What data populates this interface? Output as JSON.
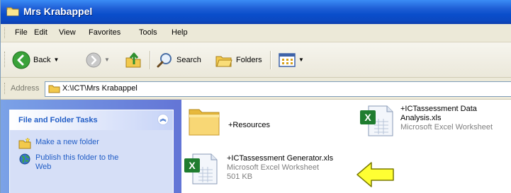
{
  "window": {
    "title": "Mrs Krabappel"
  },
  "menu": [
    "File",
    "Edit",
    "View",
    "Favorites",
    "Tools",
    "Help"
  ],
  "toolbar": {
    "back_label": "Back",
    "search_label": "Search",
    "folders_label": "Folders"
  },
  "address": {
    "label": "Address",
    "path": "X:\\ICT\\Mrs Krabappel"
  },
  "tasks": {
    "title": "File and Folder Tasks",
    "items": [
      {
        "label": "Make a new folder"
      },
      {
        "label": "Publish this folder to the Web"
      }
    ]
  },
  "files": [
    {
      "name": "+Resources",
      "type": "",
      "size": ""
    },
    {
      "name": "+ICTassessment Data Analysis.xls",
      "type": "Microsoft Excel Worksheet",
      "size": ""
    },
    {
      "name": "+ICTassessment Generator.xls",
      "type": "Microsoft Excel Worksheet",
      "size": "501 KB"
    }
  ],
  "colors": {
    "titlebar": "#0b49c2",
    "taskpane": "#6375d6",
    "task_link": "#215dc6",
    "arrow": "#ffff00"
  }
}
